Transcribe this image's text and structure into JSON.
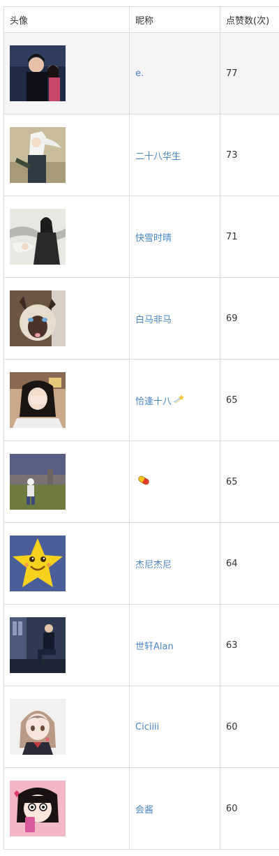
{
  "table": {
    "headers": {
      "avatar": "头像",
      "nickname": "昵称",
      "likes": "点赞数(次)"
    },
    "rows": [
      {
        "nickname": "e.",
        "likes": "77",
        "avatar_icon": "couple-photo-avatar",
        "nickname_icon": ""
      },
      {
        "nickname": "二十八华生",
        "likes": "73",
        "avatar_icon": "anime-white-hair-avatar",
        "nickname_icon": ""
      },
      {
        "nickname": "快雪时晴",
        "likes": "71",
        "avatar_icon": "ink-wash-swordsman-avatar",
        "nickname_icon": ""
      },
      {
        "nickname": "白马非马",
        "likes": "69",
        "avatar_icon": "siamese-cat-avatar",
        "nickname_icon": ""
      },
      {
        "nickname": "恰逢十八",
        "likes": "65",
        "avatar_icon": "girl-selfie-avatar",
        "nickname_icon": "shooting-star-icon"
      },
      {
        "nickname": "",
        "likes": "65",
        "avatar_icon": "figure-on-lawn-avatar",
        "nickname_icon": "pill-icon"
      },
      {
        "nickname": "杰尼杰尼",
        "likes": "64",
        "avatar_icon": "yellow-star-cartoon-avatar",
        "nickname_icon": ""
      },
      {
        "nickname": "世轩Alan",
        "likes": "63",
        "avatar_icon": "man-on-street-avatar",
        "nickname_icon": ""
      },
      {
        "nickname": "Ciciiii",
        "likes": "60",
        "avatar_icon": "anime-girl-avatar",
        "nickname_icon": ""
      },
      {
        "nickname": "会酱",
        "likes": "60",
        "avatar_icon": "cartoon-girl-phone-avatar",
        "nickname_icon": ""
      }
    ]
  },
  "colors": {
    "link": "#4a86c5",
    "border": "#dcdcdc",
    "highlight_row": "#f5f5f5",
    "text": "#333333"
  }
}
